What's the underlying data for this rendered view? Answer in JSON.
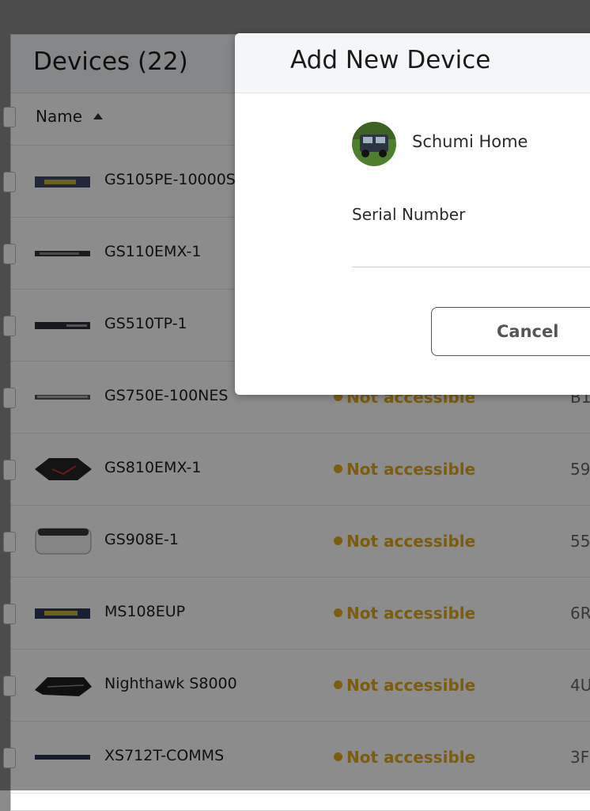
{
  "devices_panel": {
    "title": "Devices (22)",
    "column_name": "Name"
  },
  "devices": [
    {
      "name": "GS105PE-10000S",
      "status": "",
      "serial": "",
      "thumb": "blue-switch"
    },
    {
      "name": "GS110EMX-1",
      "status": "",
      "serial": "",
      "thumb": "slim-switch"
    },
    {
      "name": "GS510TP-1",
      "status": "",
      "serial": "",
      "thumb": "dark-switch"
    },
    {
      "name": "GS750E-100NES",
      "status": "Not accessible",
      "serial": "B1",
      "thumb": "long-switch"
    },
    {
      "name": "GS810EMX-1",
      "status": "Not accessible",
      "serial": "59",
      "thumb": "nighthawk-red"
    },
    {
      "name": "GS908E-1",
      "status": "Not accessible",
      "serial": "55",
      "thumb": "white-switch"
    },
    {
      "name": "MS108EUP",
      "status": "Not accessible",
      "serial": "6R",
      "thumb": "blue-switch"
    },
    {
      "name": "Nighthawk S8000",
      "status": "Not accessible",
      "serial": "4U",
      "thumb": "nighthawk"
    },
    {
      "name": "XS712T-COMMS",
      "status": "Not accessible",
      "serial": "3F",
      "thumb": "slim-switch"
    }
  ],
  "modal": {
    "title": "Add New Device",
    "location_name": "Schumi Home",
    "serial_label": "Serial Number",
    "serial_value": "",
    "cancel_label": "Cancel"
  },
  "colors": {
    "status_warning": "#e0a81f",
    "overlay": "rgba(0,0,0,0.45)"
  }
}
